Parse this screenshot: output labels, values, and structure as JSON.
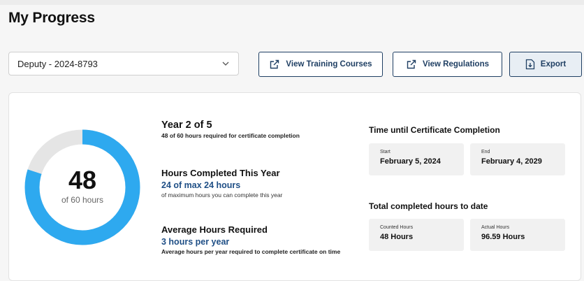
{
  "page": {
    "title": "My Progress"
  },
  "filters": {
    "selected": "Deputy - 2024-8793"
  },
  "toolbar": {
    "view_training_courses": "View Training Courses",
    "view_regulations": "View Regulations",
    "export": "Export"
  },
  "progress": {
    "completed": "48",
    "of_total": "of 60 hours",
    "fraction": 0.8,
    "color_done": "#2ea9ef",
    "color_remaining": "#e5e5e5"
  },
  "year": {
    "title": "Year 2 of 5",
    "subtitle": "48 of 60 hours required for certificate completion"
  },
  "hours_year": {
    "title": "Hours Completed This Year",
    "value": "24 of max 24 hours",
    "note": "of maximum hours you can complete this year"
  },
  "avg": {
    "title": "Average Hours Required",
    "value": "3 hours per year",
    "note": "Average hours per year required to complete certificate on time"
  },
  "time_until": {
    "heading": "Time until Certificate Completion",
    "start_label": "Start",
    "start_value": "February 5, 2024",
    "end_label": "End",
    "end_value": "February 4, 2029"
  },
  "totals": {
    "heading": "Total completed hours to date",
    "counted_label": "Counted Hours",
    "counted_value": "48 Hours",
    "actual_label": "Actual Hours",
    "actual_value": "96.59 Hours"
  }
}
